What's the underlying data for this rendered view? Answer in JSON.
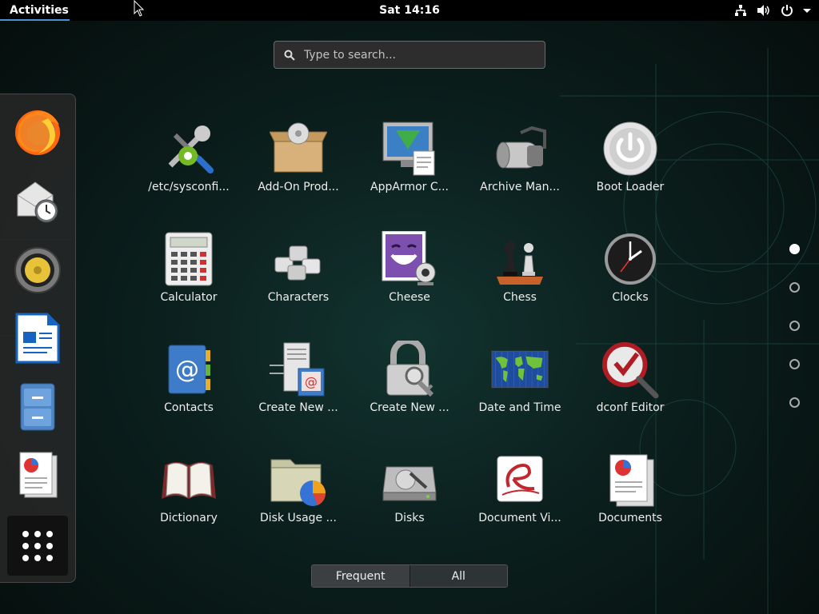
{
  "topbar": {
    "activities": "Activities",
    "clock": "Sat 14:16",
    "icons": [
      "network-icon",
      "volume-icon",
      "power-icon",
      "menu-arrow-icon"
    ]
  },
  "search": {
    "placeholder": "Type to search..."
  },
  "dash": {
    "items": [
      "Firefox",
      "Evolution",
      "Rhythmbox",
      "LibreOffice Writer",
      "Files",
      "Documents"
    ],
    "show_apps": "Show Applications"
  },
  "apps": [
    {
      "label": "/etc/sysconfi...",
      "icon": "yast-tools-icon"
    },
    {
      "label": "Add-On Prod...",
      "icon": "addon-box-icon"
    },
    {
      "label": "AppArmor C...",
      "icon": "apparmor-icon"
    },
    {
      "label": "Archive Man...",
      "icon": "archive-roller-icon"
    },
    {
      "label": "Boot Loader",
      "icon": "boot-power-icon"
    },
    {
      "label": "Calculator",
      "icon": "calculator-icon"
    },
    {
      "label": "Characters",
      "icon": "characters-keys-icon"
    },
    {
      "label": "Cheese",
      "icon": "cheese-webcam-icon"
    },
    {
      "label": "Chess",
      "icon": "chess-icon"
    },
    {
      "label": "Clocks",
      "icon": "clock-icon"
    },
    {
      "label": "Contacts",
      "icon": "contacts-book-icon"
    },
    {
      "label": "Create New ...",
      "icon": "server-mail-icon"
    },
    {
      "label": "Create New ...",
      "icon": "padlock-key-icon"
    },
    {
      "label": "Date and Time",
      "icon": "world-map-icon"
    },
    {
      "label": "dconf Editor",
      "icon": "dconf-magnifier-icon"
    },
    {
      "label": "Dictionary",
      "icon": "book-icon"
    },
    {
      "label": "Disk Usage ...",
      "icon": "folder-chart-icon"
    },
    {
      "label": "Disks",
      "icon": "disk-drive-icon"
    },
    {
      "label": "Document Vi...",
      "icon": "document-viewer-icon"
    },
    {
      "label": "Documents",
      "icon": "documents-icon"
    }
  ],
  "pages": {
    "count": 5,
    "active": 1
  },
  "switch": {
    "frequent": "Frequent",
    "all": "All"
  },
  "colors": {
    "accent": "#4a90d9",
    "topbar": "#000000"
  }
}
